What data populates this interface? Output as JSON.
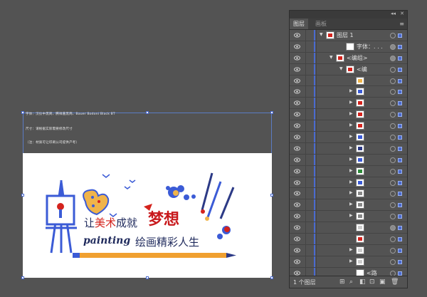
{
  "artboard": {
    "spec_lines": [
      "字体：汉仪中黑简、腾祥嘉黑简、Bauer Bodoni Black BT",
      "尺寸：请根据实际需要修改尺寸",
      "（注：材质可让印刷公司提供产考）"
    ],
    "slogan_prefix": "让",
    "slogan_highlight": "美术",
    "slogan_suffix": "成就",
    "slogan_dream": "梦想",
    "painting_word": "painting",
    "slogan_line2": "绘画精彩人生"
  },
  "layers_panel": {
    "tabs": [
      {
        "label": "图层"
      },
      {
        "label": "画板"
      }
    ],
    "rows": [
      {
        "label": "图层 1",
        "arrow": "▼",
        "indent": 0,
        "target_filled": false,
        "thumb": "red"
      },
      {
        "label": "字体：. . .",
        "arrow": "",
        "indent": 2,
        "target_filled": true,
        "thumb": "white"
      },
      {
        "label": "<编组>",
        "arrow": "▼",
        "indent": 1,
        "target_filled": true,
        "thumb": "red"
      },
      {
        "label": "<编",
        "arrow": "▼",
        "indent": 2,
        "target_filled": false,
        "thumb": "red"
      },
      {
        "label": "",
        "arrow": "",
        "indent": 3,
        "target_filled": false,
        "thumb": "orange"
      },
      {
        "label": "",
        "arrow": "▶",
        "indent": 3,
        "target_filled": false,
        "thumb": "blue"
      },
      {
        "label": "",
        "arrow": "▶",
        "indent": 3,
        "target_filled": false,
        "thumb": "red"
      },
      {
        "label": "",
        "arrow": "▶",
        "indent": 3,
        "target_filled": false,
        "thumb": "red"
      },
      {
        "label": "",
        "arrow": "▶",
        "indent": 3,
        "target_filled": false,
        "thumb": "red"
      },
      {
        "label": "",
        "arrow": "▶",
        "indent": 3,
        "target_filled": false,
        "thumb": "blue"
      },
      {
        "label": "",
        "arrow": "▶",
        "indent": 3,
        "target_filled": false,
        "thumb": "navy"
      },
      {
        "label": "",
        "arrow": "▶",
        "indent": 3,
        "target_filled": false,
        "thumb": "blue"
      },
      {
        "label": "",
        "arrow": "▶",
        "indent": 3,
        "target_filled": false,
        "thumb": "green"
      },
      {
        "label": "",
        "arrow": "▶",
        "indent": 3,
        "target_filled": false,
        "thumb": "blue"
      },
      {
        "label": "",
        "arrow": "▶",
        "indent": 3,
        "target_filled": false,
        "thumb": "line"
      },
      {
        "label": "",
        "arrow": "▶",
        "indent": 3,
        "target_filled": false,
        "thumb": "line"
      },
      {
        "label": "",
        "arrow": "▶",
        "indent": 3,
        "target_filled": false,
        "thumb": "line"
      },
      {
        "label": "",
        "arrow": "",
        "indent": 3,
        "target_filled": true,
        "thumb": "text"
      },
      {
        "label": "",
        "arrow": "",
        "indent": 3,
        "target_filled": false,
        "thumb": "red"
      },
      {
        "label": "",
        "arrow": "▶",
        "indent": 3,
        "target_filled": false,
        "thumb": "text"
      },
      {
        "label": "",
        "arrow": "▶",
        "indent": 3,
        "target_filled": false,
        "thumb": "text"
      },
      {
        "label": "<路",
        "arrow": "",
        "indent": 3,
        "target_filled": false,
        "thumb": "white"
      }
    ],
    "footer_count": "1 个图层"
  },
  "colors": {
    "canvas_bg": "#535353",
    "selection_blue": "#4a6ad0",
    "slogan_navy": "#1f2a5c",
    "slogan_red": "#d4231d",
    "artboard_white": "#ffffff"
  }
}
